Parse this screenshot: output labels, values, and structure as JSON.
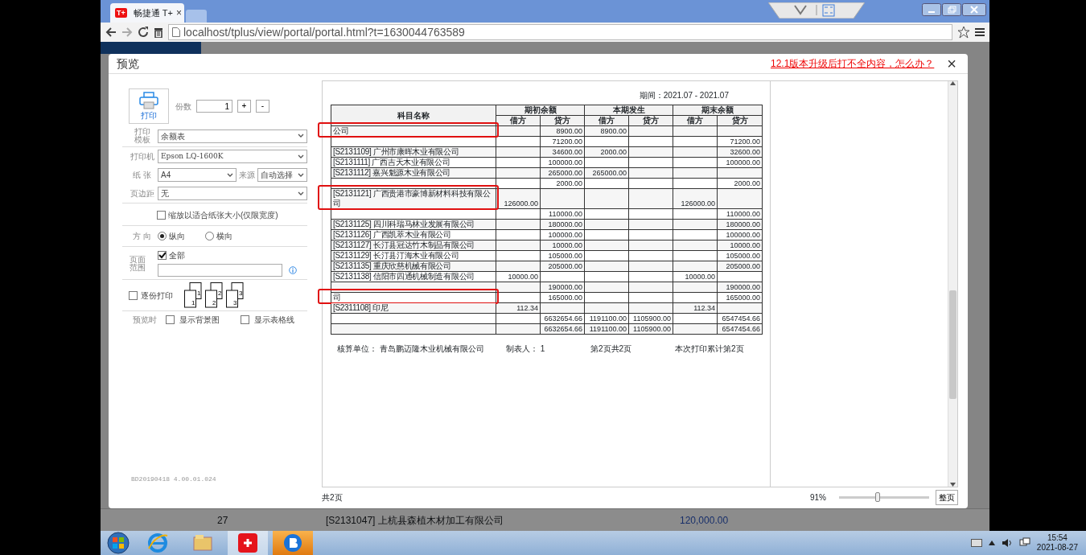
{
  "browser": {
    "tab": {
      "logo": "T+",
      "title": "畅捷通 T+",
      "close": "×"
    },
    "address": "localhost/tplus/view/portal/portal.html?t=1630044763589"
  },
  "dialog": {
    "title": "预览",
    "help_link": "12.1版本升级后打不全内容，怎么办？",
    "close": "×",
    "settings": {
      "print_button": "打印",
      "copies_label": "份数",
      "copies": "1",
      "plus": "+",
      "minus": "-",
      "template_label": "打印模板",
      "template": "余额表",
      "printer_label": "打印机",
      "printer": "Epson LQ-1600K",
      "paper_label": "纸 张",
      "paper": "A4",
      "source_label": "来源",
      "source": "自动选择",
      "margin_label": "页边距",
      "margin": "无",
      "fit_width": {
        "label": "缩放以适合纸张大小(仅限宽度)",
        "checked": false
      },
      "orientation_label": "方 向",
      "orientations": [
        {
          "label": "纵向",
          "selected": true
        },
        {
          "label": "横向",
          "selected": false
        }
      ],
      "range_label": "页面范围",
      "range_all": {
        "label": "全部",
        "checked": true
      },
      "collate": {
        "label": "逐份打印",
        "checked": false
      },
      "collate_icons": [
        {
          "back": "1",
          "front": "1"
        },
        {
          "back": "2",
          "front": "2"
        },
        {
          "back": "3",
          "front": "3"
        }
      ],
      "preview_label": "预览时",
      "preview_options": [
        {
          "label": "显示背景图",
          "checked": false
        },
        {
          "label": "显示表格线",
          "checked": false
        }
      ],
      "version": "BD20190418 4.00.01.024"
    },
    "page": {
      "period": "期间：2021.07 - 2021.07",
      "name_header": "科目名称",
      "groups": [
        "期初余额",
        "本期发生",
        "期末余额"
      ],
      "sub_headers": [
        "借方",
        "贷方",
        "借方",
        "贷方",
        "借方",
        "贷方"
      ],
      "rows": [
        {
          "name": "公司",
          "opening_credit": "8900.00",
          "period_debit": "8900.00",
          "marked": true
        },
        {
          "opening_credit": "71200.00",
          "closing_credit": "71200.00",
          "marked": false
        },
        {
          "name": "[S2131109] 广州市康晖木业有限公司",
          "opening_credit": "34600.00",
          "period_debit": "2000.00",
          "closing_credit": "32600.00",
          "marked": false
        },
        {
          "name": "[S2131111] 广西吉天木业有限公司",
          "opening_credit": "100000.00",
          "closing_credit": "100000.00",
          "marked": false
        },
        {
          "name": "[S2131112] 嘉兴魁源木业有限公司",
          "opening_credit": "265000.00",
          "period_debit": "265000.00",
          "marked": false
        },
        {
          "opening_credit": "2000.00",
          "closing_credit": "2000.00",
          "marked": false
        },
        {
          "name": "[S2131121] 广西贵港市豪博新材料科技有限公司",
          "opening_debit": "126000.00",
          "closing_debit": "126000.00",
          "marked": true
        },
        {
          "opening_credit": "110000.00",
          "closing_credit": "110000.00",
          "marked": false
        },
        {
          "name": "[S2131125] 四川科瑞马林业发展有限公司",
          "opening_credit": "180000.00",
          "closing_credit": "180000.00",
          "marked": false
        },
        {
          "name": "[S2131126] 广西凯萃木业有限公司",
          "opening_credit": "100000.00",
          "closing_credit": "100000.00",
          "marked": false
        },
        {
          "name": "[S2131127] 长汀县冠达竹木制品有限公司",
          "opening_credit": "10000.00",
          "closing_credit": "10000.00",
          "marked": false
        },
        {
          "name": "[S2131129] 长汀县汀海木业有限公司",
          "opening_credit": "105000.00",
          "closing_credit": "105000.00",
          "marked": false
        },
        {
          "name": "[S2131135] 重庆欣慈机械有限公司",
          "opening_credit": "205000.00",
          "closing_credit": "205000.00",
          "marked": false
        },
        {
          "name": "[S2131138] 信阳市四通机械制造有限公司",
          "opening_debit": "10000.00",
          "closing_debit": "10000.00",
          "marked": false
        },
        {
          "opening_credit": "190000.00",
          "closing_credit": "190000.00",
          "marked": false
        },
        {
          "name": "司",
          "opening_credit": "165000.00",
          "closing_credit": "165000.00",
          "marked": true
        },
        {
          "name": "[S2311108] 印尼",
          "opening_debit": "112.34",
          "closing_debit": "112.34",
          "marked": false
        },
        {
          "opening_credit": "6632654.66",
          "period_debit": "1191100.00",
          "period_credit": "1105900.00",
          "closing_credit": "6547454.66",
          "marked": false
        },
        {
          "opening_credit": "6632654.66",
          "period_debit": "1191100.00",
          "period_credit": "1105900.00",
          "closing_credit": "6547454.66",
          "marked": false
        }
      ],
      "footer": [
        "核算单位： 青岛鹏迈隆木业机械有限公司",
        "制表人： 1",
        "第2页共2页",
        "本次打印累计第2页"
      ]
    },
    "page_count": "共2页",
    "zoom": "91%",
    "zoom_slider": {
      "level": 0.43
    },
    "fit_button": "整页"
  },
  "background_row": {
    "number": "27",
    "account": "[S2131047] 上杭县森植木材加工有限公司",
    "amount": "120,000.00"
  },
  "taskbar": {
    "time": "15:54",
    "date": "2021-08-27"
  }
}
